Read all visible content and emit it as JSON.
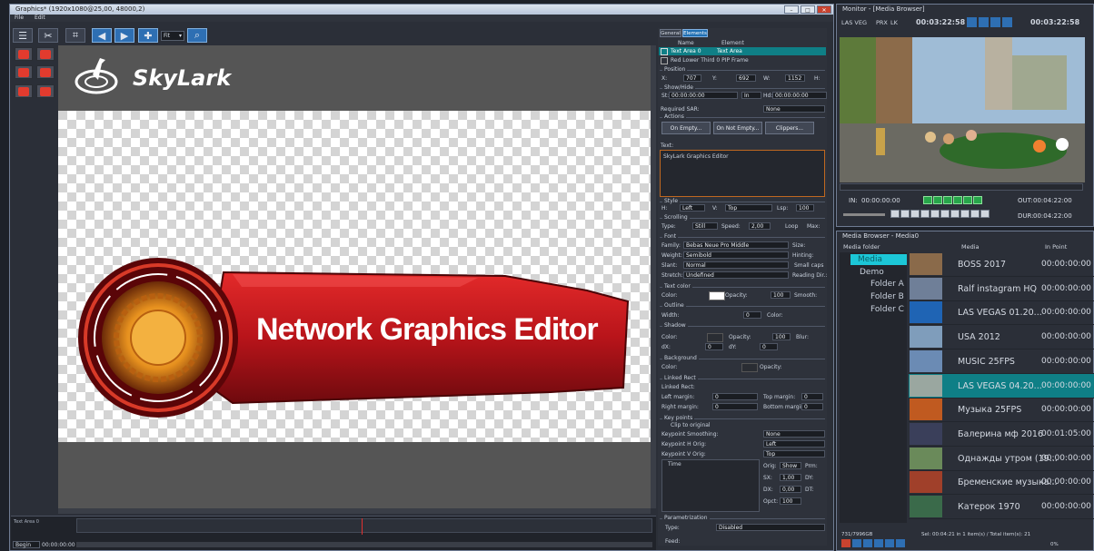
{
  "graphics_window": {
    "title": "Graphics* (1920x1080@25,00, 48000,2)",
    "menu": [
      "File",
      "Edit"
    ],
    "zoom_value": "Fit",
    "logo_text": "SkyLark",
    "banner_text": "Network Graphics Editor",
    "timeline": {
      "track_label": "Text Area 0",
      "begin_label": "Begin",
      "timecode": "00:00:00:00"
    }
  },
  "properties": {
    "tabs": [
      "General",
      "Elements"
    ],
    "columns": [
      "Name",
      "Element"
    ],
    "elements": [
      {
        "name": "Text Area 0",
        "element": "Text Area"
      },
      {
        "name": "Red Lower Third 0 PIP Frame",
        "element": ""
      }
    ],
    "position": {
      "label": "Position",
      "x_label": "X:",
      "x": "707",
      "y_label": "Y:",
      "y": "692",
      "w_label": "W:",
      "w": "1152",
      "h_label": "H:"
    },
    "timing": {
      "label": "Show/Hide",
      "start_label": "St:",
      "start": "00:00:00:00",
      "in": "In",
      "hold_label": "Hd:",
      "hold": "00:00:00:00"
    },
    "sar": {
      "label": "Required SAR:",
      "value": "None"
    },
    "actions": {
      "label": "Actions",
      "buttons": [
        "On Empty...",
        "On Not Empty...",
        "Clippers..."
      ]
    },
    "text": {
      "label": "Text:",
      "value": "SkyLark Graphics Editor"
    },
    "style": {
      "label": "Style",
      "h_label": "H:",
      "h": "Left",
      "v_label": "V:",
      "v": "Top",
      "lsp_label": "Lsp:",
      "lsp": "100"
    },
    "scrolling": {
      "label": "Scrolling",
      "type_label": "Type:",
      "type": "Still",
      "speed_label": "Speed:",
      "speed": "2,00",
      "loop": "Loop",
      "max": "Max:"
    },
    "font": {
      "label": "Font",
      "family_label": "Family:",
      "family": "Bebas Neue Pro Middle",
      "size": "Size:",
      "weight_label": "Weight:",
      "weight": "Semibold",
      "hinting": "Hinting:",
      "slant_label": "Slant:",
      "slant": "Normal",
      "small_caps": "Small caps",
      "stretch_label": "Stretch:",
      "stretch": "Undefined",
      "reading": "Reading Dir.:"
    },
    "text_color": {
      "label": "Text color",
      "color_label": "Color:",
      "opacity_label": "Opacity:",
      "opacity": "100",
      "smooth": "Smooth:"
    },
    "outline": {
      "label": "Outline",
      "width_label": "Width:",
      "width": "0",
      "color_label": "Color:"
    },
    "shadow": {
      "label": "Shadow",
      "color_label": "Color:",
      "opacity_label": "Opacity:",
      "opacity": "100",
      "blur": "Blur:",
      "dx_label": "dX:",
      "dx": "0",
      "dy_label": "dY:",
      "dy": "0"
    },
    "background": {
      "label": "Background",
      "color_label": "Color:",
      "opacity_label": "Opacity:"
    },
    "linked_rect": {
      "label": "Linked Rect",
      "sub": "Linked Rect:",
      "left_label": "Left margin:",
      "left": "0",
      "top_label": "Top margin:",
      "top": "0",
      "right_label": "Right margin:",
      "right": "0",
      "bottom_label": "Bottom margin:",
      "bottom": "0"
    },
    "keypoints": {
      "label": "Key points",
      "clip": "Clip to original",
      "smooth_label": "Keypoint Smoothing:",
      "smooth": "None",
      "h_label": "Keypoint H Orig:",
      "h": "Left",
      "v_label": "Keypoint V Orig:",
      "v": "Top",
      "time_col": "Time",
      "orig_label": "Orig:",
      "orig": "Show",
      "prm": "Prm:",
      "sx_label": "SX:",
      "sx": "1,00",
      "dy_label": "DY:",
      "dx_label": "DX:",
      "dx": "0,00",
      "dt_label": "DT:",
      "opct_label": "Opct:",
      "opct": "100"
    },
    "parametrization": {
      "label": "Parametrization",
      "type_label": "Type:",
      "type": "Disabled",
      "feed": "Feed:"
    }
  },
  "monitor": {
    "title": "Monitor - [Media Browser]",
    "source": "LAS VEG",
    "prx": "PRX",
    "lk": "LK",
    "in_timecode": "00:03:22:58",
    "b_timecode": "00:03:22:58",
    "in_label": "IN:",
    "in": "00:00:00:00",
    "out_label": "OUT:",
    "out": "00:04:22:00",
    "dur_label": "DUR:",
    "dur": "00:04:22:00"
  },
  "media_browser": {
    "title": "Media Browser - Media0",
    "col_folder": "Media folder",
    "col_media": "Media",
    "col_inpoint": "In Point",
    "tree": [
      "Media",
      "Demo",
      "Folder A",
      "Folder B",
      "Folder C"
    ],
    "items": [
      {
        "name": "BOSS 2017",
        "in": "00:00:00:00",
        "color": "#8a6a4a"
      },
      {
        "name": "Ralf instagram HQ",
        "in": "00:00:00:00",
        "color": "#6f7f98"
      },
      {
        "name": "LAS VEGAS 01.20...",
        "in": "00:00:00:00",
        "color": "#1f64b4"
      },
      {
        "name": "USA 2012",
        "in": "00:00:00:00",
        "color": "#7f9dbb"
      },
      {
        "name": "MUSIC 25FPS",
        "in": "00:00:00:00",
        "color": "#6b8bb4"
      },
      {
        "name": "LAS VEGAS 04.20...",
        "in": "00:00:00:00",
        "color": "#9aa7a0",
        "selected": true
      },
      {
        "name": "Музыка 25FPS",
        "in": "00:00:00:00",
        "color": "#c05a20"
      },
      {
        "name": "Балерина мф 2016",
        "in": "00:01:05:00",
        "color": "#3a3f5a"
      },
      {
        "name": "Однажды утром (19...",
        "in": "00:00:00:00",
        "color": "#6a8a5a"
      },
      {
        "name": "Бременские музыка...",
        "in": "00:00:00:00",
        "color": "#a0402a"
      },
      {
        "name": "Катерок 1970",
        "in": "00:00:00:00",
        "color": "#3a6a4a"
      }
    ],
    "footer_left": "731/7996GB",
    "footer_sel": "Sel: 00:04:21 in 1 item(s) / Total item(s): 21",
    "footer_pct": "0%"
  },
  "colors": {
    "accent": "#2e6fb3",
    "selected_row": "#0f7f86",
    "banner_red": "#c0161b",
    "green_btn": "#27a64a"
  }
}
